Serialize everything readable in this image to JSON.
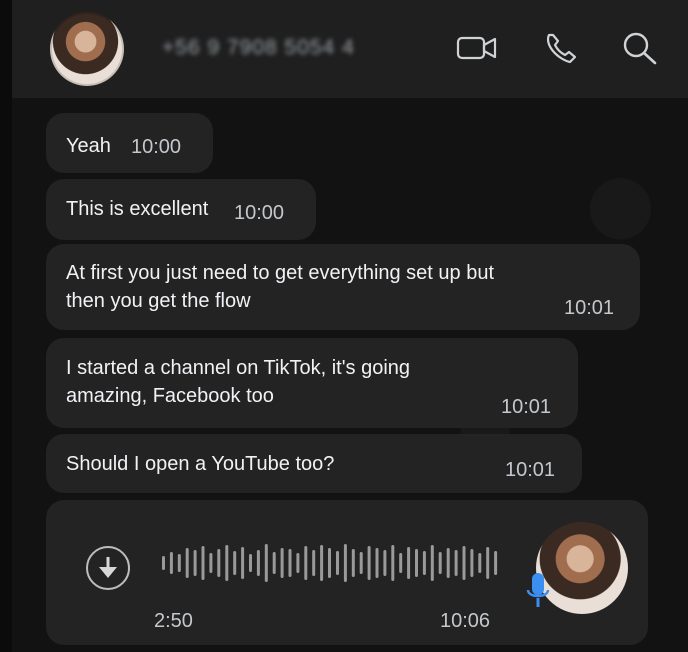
{
  "header": {
    "contact_number": "+56 9 7908 5054 4",
    "icons": [
      "video-call-icon",
      "voice-call-icon",
      "search-icon"
    ]
  },
  "messages": [
    {
      "text": "Yeah",
      "time": "10:00"
    },
    {
      "text": "This is excellent",
      "time": "10:00"
    },
    {
      "text": "At first you just need to get everything set up but then you get the flow",
      "time": "10:01"
    },
    {
      "text": "I started a channel on TikTok, it's going amazing, Facebook too",
      "time": "10:01"
    },
    {
      "text": "Should I open a YouTube too?",
      "time": "10:01"
    }
  ],
  "voice_message": {
    "duration": "2:50",
    "time": "10:06"
  },
  "colors": {
    "header_bg": "#1f1f1f",
    "bubble_bg": "#232323",
    "mic_accent": "#3b8ff0"
  }
}
